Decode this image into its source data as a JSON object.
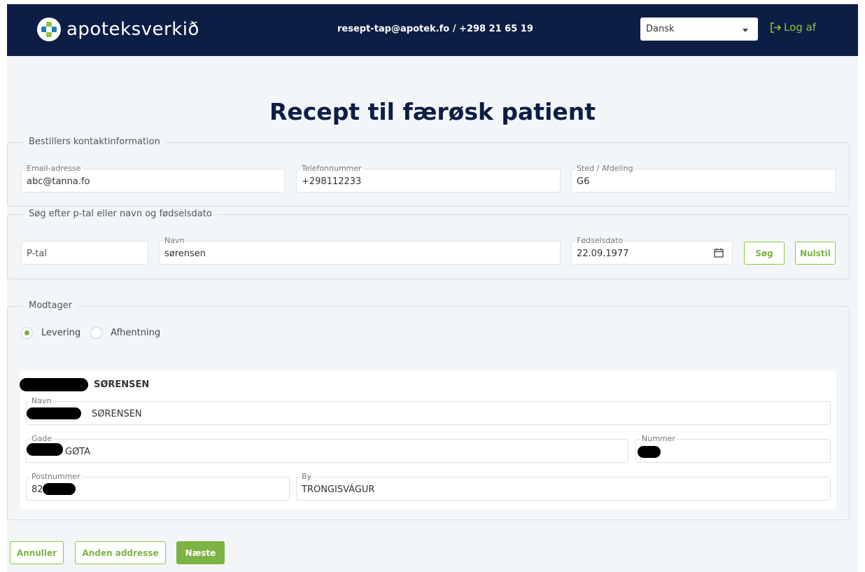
{
  "header": {
    "logo_text": "apoteksverkið",
    "contact": "resept-tap@apotek.fo / +298 21 65 19",
    "language": "Dansk",
    "logout_label": "Log af"
  },
  "page_title": "Recept til færøsk patient",
  "orderer": {
    "legend": "Bestillers kontaktinformation",
    "email_label": "Email-adresse",
    "email_value": "abc@tanna.fo",
    "phone_label": "Telefonnummer",
    "phone_value": "+298112233",
    "dept_label": "Sted / Afdeling",
    "dept_value": "G6"
  },
  "search": {
    "legend": "Søg efter p-tal eller navn og fødselsdato",
    "ptal_placeholder": "P-tal",
    "name_label": "Navn",
    "name_value": "sørensen",
    "dob_label": "Fødselsdato",
    "dob_value": "22.09.1977",
    "search_button": "Søg",
    "reset_button": "Nulstil"
  },
  "recipient": {
    "legend": "Modtager",
    "options": [
      "Levering",
      "Afhentning"
    ],
    "selected": "Levering",
    "card_title": "SØRENSEN",
    "name_label": "Navn",
    "name_value": "SØRENSEN",
    "street_label": "Gade",
    "street_value": "GØTA",
    "number_label": "Nummer",
    "postal_label": "Postnummer",
    "postal_value": "82",
    "city_label": "By",
    "city_value": "TRONGISVÁGUR"
  },
  "actions": {
    "cancel": "Annuller",
    "other_address": "Anden addresse",
    "next": "Næste"
  },
  "colors": {
    "navy": "#0d1e45",
    "green": "#7cb342",
    "background": "#f3f6f9"
  }
}
